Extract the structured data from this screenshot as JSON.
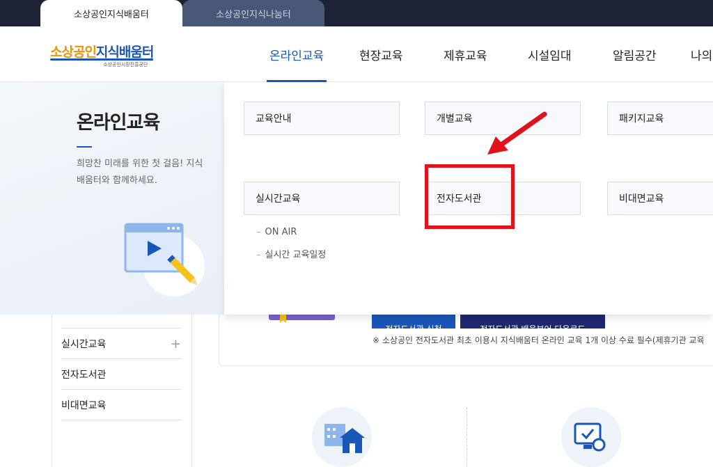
{
  "site_tabs": [
    {
      "label": "소상공인지식배움터",
      "active": true
    },
    {
      "label": "소상공인지식나눔터",
      "active": false
    }
  ],
  "logo": {
    "title_orange": "소상공인",
    "title_blue": "지식배움터",
    "subtitle": "소상공인시장진흥공단"
  },
  "gnb": [
    {
      "label": "온라인교육",
      "active": true
    },
    {
      "label": "현장교육",
      "active": false
    },
    {
      "label": "제휴교육",
      "active": false
    },
    {
      "label": "시설임대",
      "active": false
    },
    {
      "label": "알림공간",
      "active": false
    },
    {
      "label": "나의",
      "active": false
    }
  ],
  "mega": {
    "title": "온라인교육",
    "description": "희망찬 미래를 위한 첫 걸음! 지식배움터와 함께하세요.",
    "items": [
      {
        "label": "교육안내"
      },
      {
        "label": "개별교육"
      },
      {
        "label": "패키지교육"
      },
      {
        "label": "실시간교육"
      },
      {
        "label": "전자도서관"
      },
      {
        "label": "비대면교육"
      }
    ],
    "sub_items": [
      "ON AIR",
      "실시간 교육일정"
    ],
    "sub_prefix": "–"
  },
  "sidebar": {
    "items": [
      {
        "label": "실시간교육",
        "has_plus": true
      },
      {
        "label": "전자도서관",
        "has_plus": false
      },
      {
        "label": "비대면교육",
        "has_plus": false
      }
    ],
    "plus_symbol": "+"
  },
  "background_card": {
    "btn_apply": "전자도서관 신청",
    "btn_download": "전자도서관 배움뷰어 다운로드",
    "notice": "※ 소상공인 전자도서관 최초 이용시 지식배움터 온라인 교육 1개 이상 수료 필수(제휴기관 교육"
  },
  "annotation": {
    "highlight_color": "#e0121b",
    "target": "전자도서관"
  },
  "colors": {
    "brand_blue": "#1a56b8",
    "brand_orange": "#f39200",
    "topbar": "#1d2234"
  }
}
